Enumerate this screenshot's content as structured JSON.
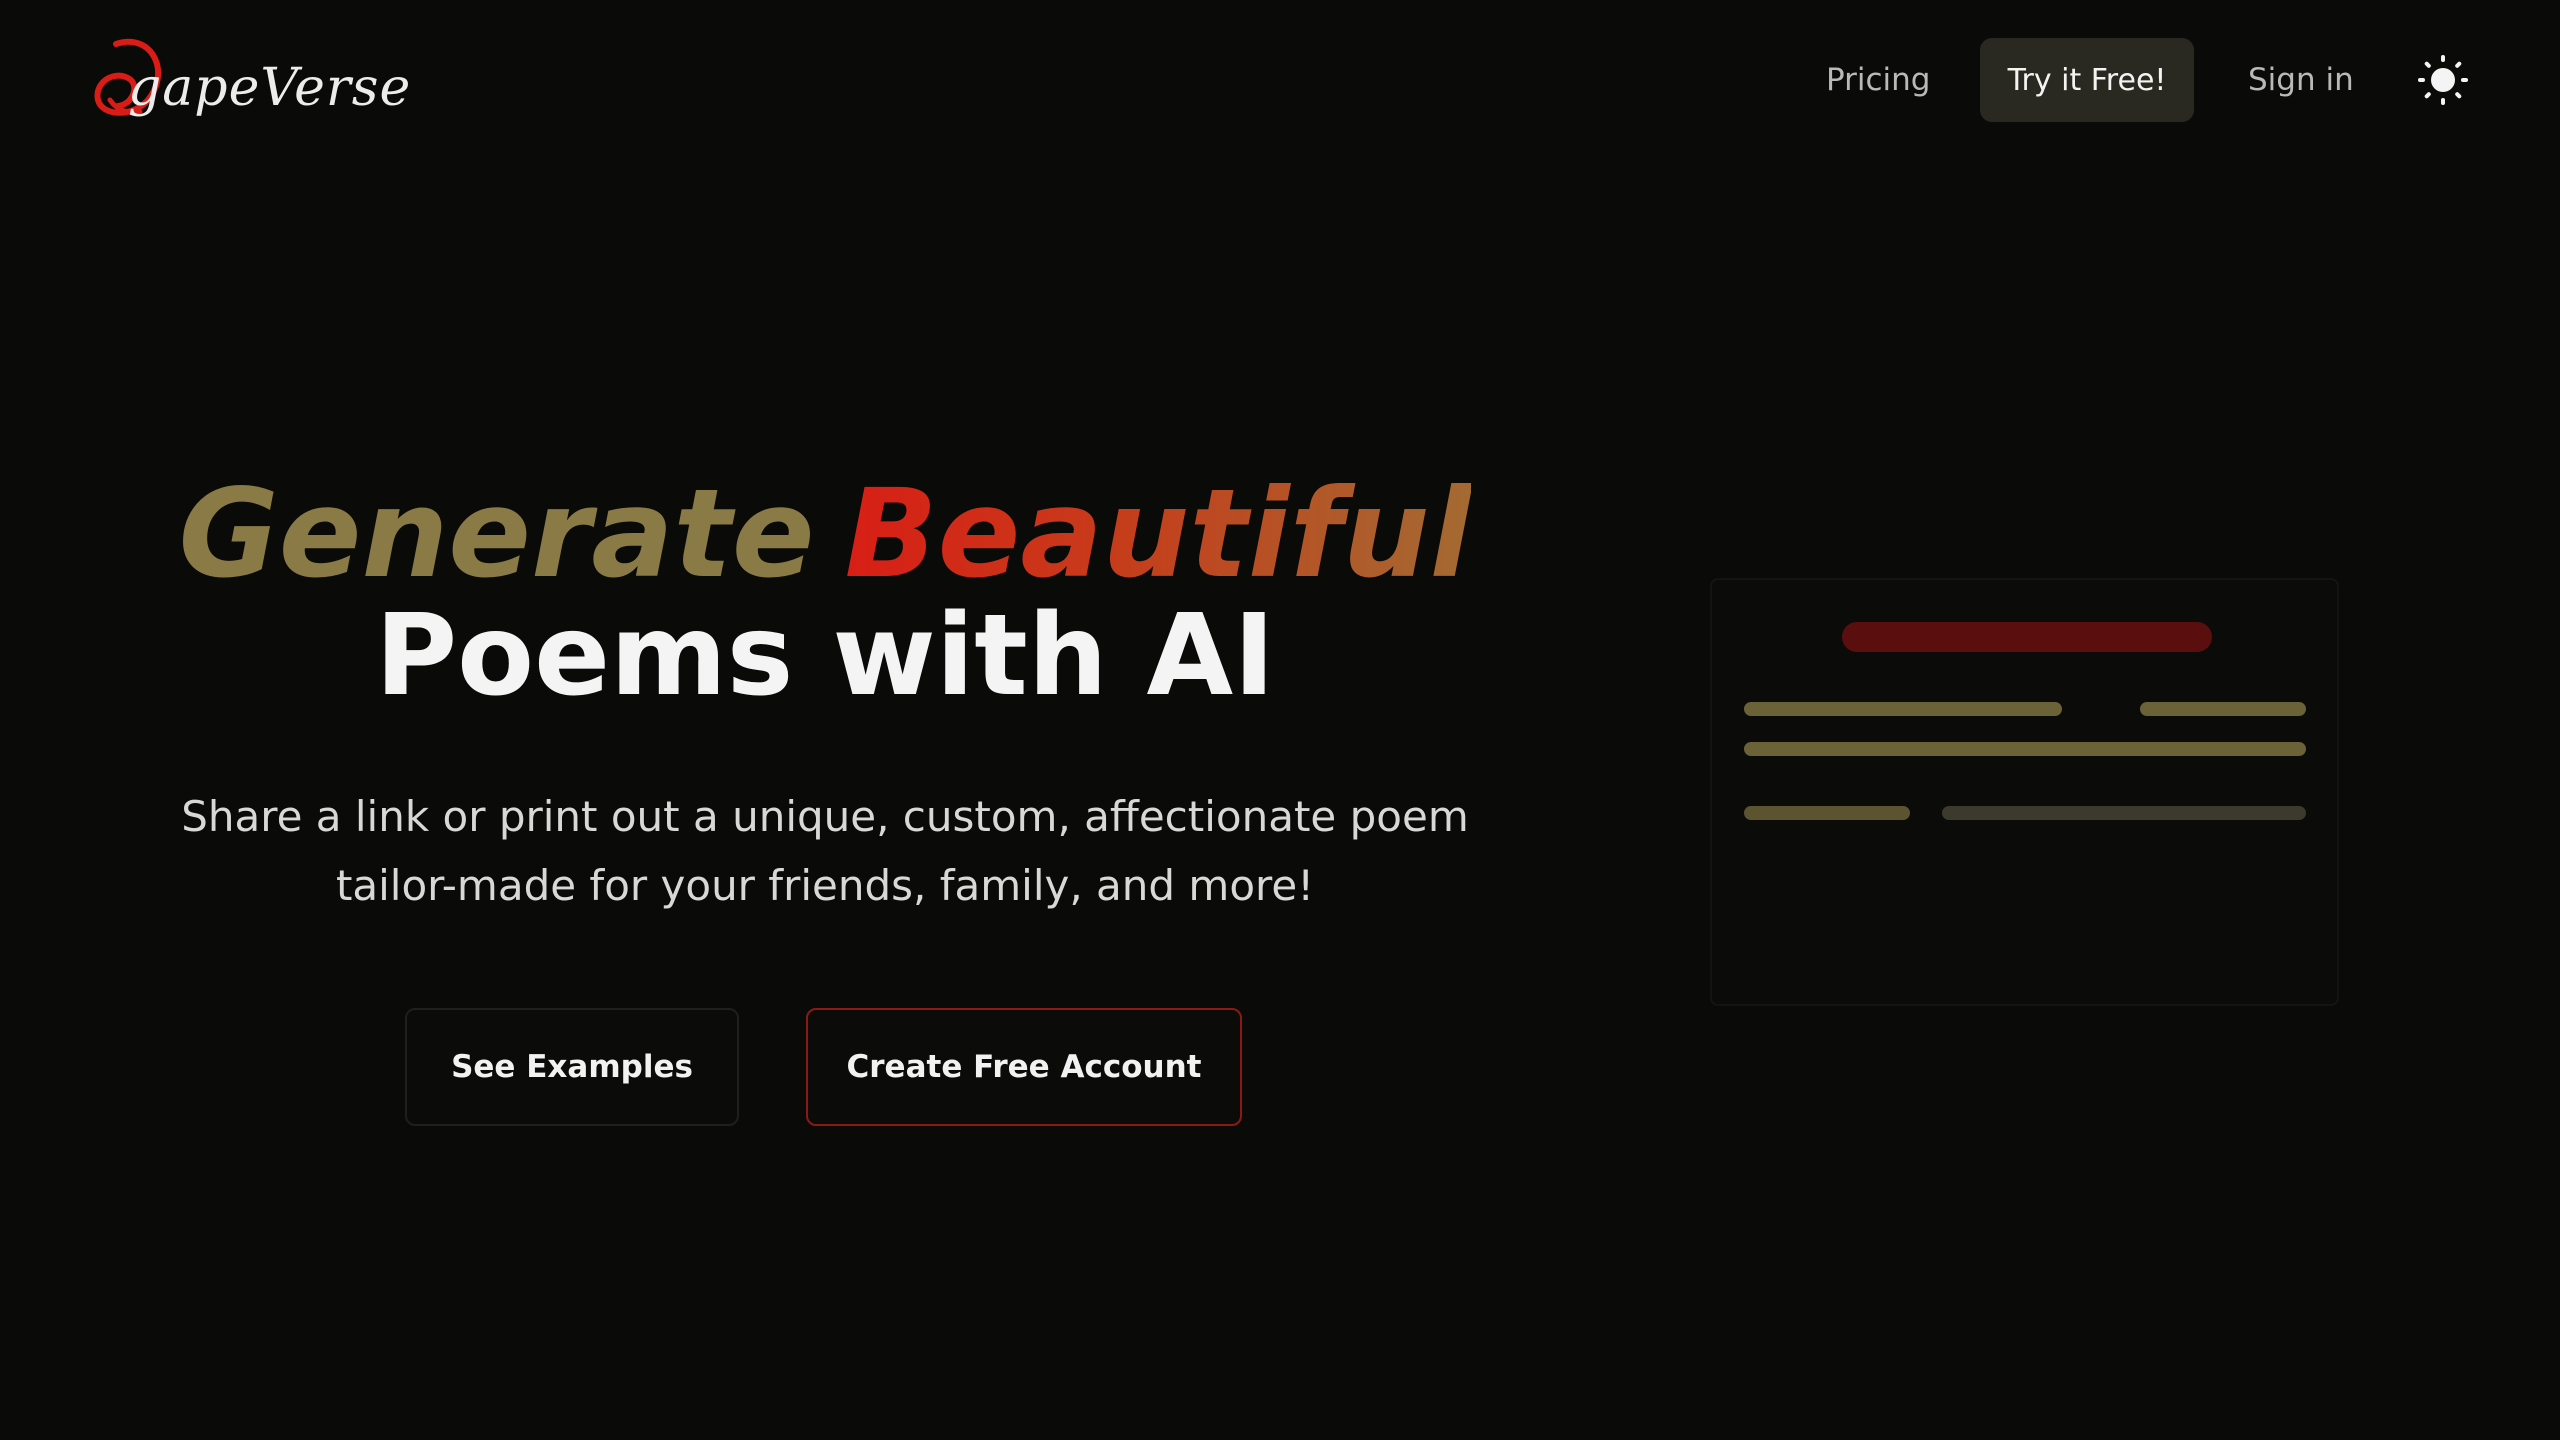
{
  "header": {
    "logo_text": "gapeVerse",
    "nav": {
      "pricing": "Pricing",
      "try_free": "Try it Free!",
      "sign_in": "Sign in"
    },
    "theme_icon": "sun-icon"
  },
  "hero": {
    "headline_word1": "Generate",
    "headline_word2": "Beautiful",
    "headline_line2": "Poems with AI",
    "subtitle": "Share a link or print out a unique, custom, affectionate poem tailor-made for your friends, family, and more!",
    "buttons": {
      "see_examples": "See Examples",
      "create_account": "Create Free Account"
    }
  },
  "colors": {
    "background": "#0a0a09",
    "accent_gold": "#8a7a45",
    "accent_red": "#d81e16",
    "button_dark": "#2a2921"
  }
}
